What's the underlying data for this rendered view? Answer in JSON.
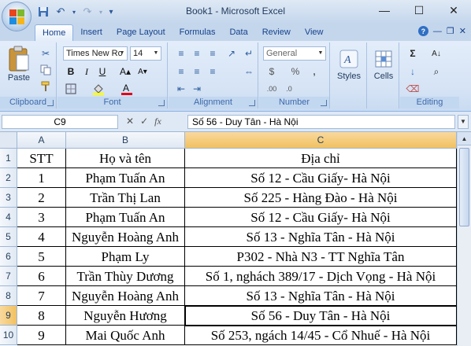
{
  "window": {
    "title": "Book1 - Microsoft Excel",
    "minimize": "—",
    "maximize": "☐",
    "close": "✕"
  },
  "quick_access": {
    "save_icon": "save-icon",
    "undo_icon": "undo-icon",
    "redo_icon": "redo-icon",
    "customize": "▾"
  },
  "tabs": [
    {
      "label": "Home",
      "active": true
    },
    {
      "label": "Insert"
    },
    {
      "label": "Page Layout"
    },
    {
      "label": "Formulas"
    },
    {
      "label": "Data"
    },
    {
      "label": "Review"
    },
    {
      "label": "View"
    }
  ],
  "ribbon": {
    "clipboard": {
      "label": "Clipboard",
      "paste": "Paste"
    },
    "font": {
      "label": "Font",
      "name": "Times New Ro",
      "size": "14",
      "bold": "B",
      "italic": "I",
      "underline": "U"
    },
    "alignment": {
      "label": "Alignment"
    },
    "number": {
      "label": "Number",
      "format": "General",
      "currency": "$",
      "percent": "%",
      "comma": ","
    },
    "styles": {
      "label": "Styles"
    },
    "cells": {
      "label": "Cells"
    },
    "editing": {
      "label": "Editing"
    }
  },
  "formula_bar": {
    "name_box": "C9",
    "fx": "fx",
    "content": "Số 56 - Duy Tân - Hà Nội"
  },
  "sheet": {
    "columns": [
      "A",
      "B",
      "C"
    ],
    "selected_column": "C",
    "selected_row": "9",
    "rows": [
      {
        "num": "1",
        "a": "STT",
        "b": "Họ và tên",
        "c": "Địa chỉ"
      },
      {
        "num": "2",
        "a": "1",
        "b": "Phạm Tuấn An",
        "c": "Số 12 - Cầu Giấy- Hà Nội"
      },
      {
        "num": "3",
        "a": "2",
        "b": "Trần Thị Lan",
        "c": "Số 225 - Hàng Đào - Hà Nội"
      },
      {
        "num": "4",
        "a": "3",
        "b": "Phạm Tuấn An",
        "c": "Số 12 - Cầu Giấy- Hà Nội"
      },
      {
        "num": "5",
        "a": "4",
        "b": "Nguyễn Hoàng Anh",
        "c": "Số 13 - Nghĩa Tân - Hà Nội"
      },
      {
        "num": "6",
        "a": "5",
        "b": "Phạm Ly",
        "c": "P302 - Nhà N3 - TT Nghĩa Tân"
      },
      {
        "num": "7",
        "a": "6",
        "b": "Trần Thùy Dương",
        "c": "Số 1, nghách 389/17 - Dịch Vọng - Hà Nội"
      },
      {
        "num": "8",
        "a": "7",
        "b": "Nguyễn Hoàng Anh",
        "c": "Số 13 - Nghĩa Tân - Hà Nội"
      },
      {
        "num": "9",
        "a": "8",
        "b": "Nguyễn Hương",
        "c": "Số 56 - Duy Tân - Hà Nội"
      },
      {
        "num": "10",
        "a": "9",
        "b": "Mai Quốc Anh",
        "c": "Số 253, ngách 14/45 - Cổ Nhuế - Hà Nội"
      }
    ]
  }
}
